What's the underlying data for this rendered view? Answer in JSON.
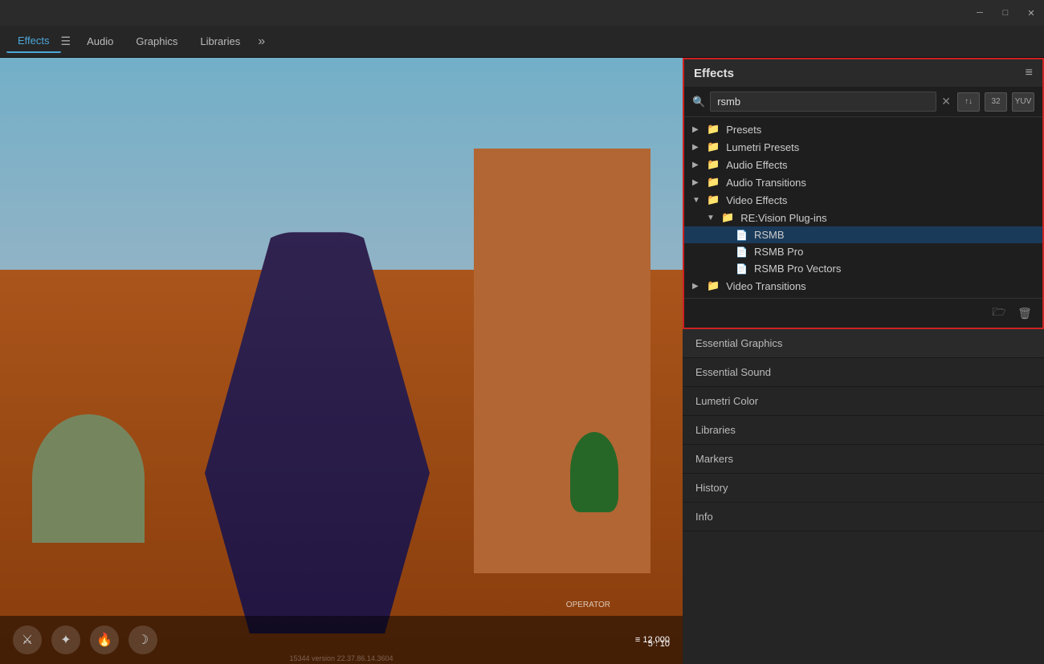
{
  "titlebar": {
    "minimize_label": "─",
    "maximize_label": "□",
    "close_label": "✕"
  },
  "tabs": {
    "items": [
      {
        "id": "effects",
        "label": "Effects",
        "active": true
      },
      {
        "id": "audio",
        "label": "Audio"
      },
      {
        "id": "graphics",
        "label": "Graphics"
      },
      {
        "id": "libraries",
        "label": "Libraries"
      }
    ],
    "more_label": "»"
  },
  "effects_panel": {
    "title": "Effects",
    "menu_icon": "≡",
    "search": {
      "placeholder": "Search",
      "value": "rsmb",
      "clear_icon": "✕",
      "btn_accelerate_label": "↑↓",
      "btn_32_label": "32",
      "btn_yuv_label": "YUV"
    },
    "tree": [
      {
        "id": "presets",
        "label": "Presets",
        "indent": 0,
        "expanded": false,
        "type": "folder"
      },
      {
        "id": "lumetri-presets",
        "label": "Lumetri Presets",
        "indent": 0,
        "expanded": false,
        "type": "folder"
      },
      {
        "id": "audio-effects",
        "label": "Audio Effects",
        "indent": 0,
        "expanded": false,
        "type": "folder"
      },
      {
        "id": "audio-transitions",
        "label": "Audio Transitions",
        "indent": 0,
        "expanded": false,
        "type": "folder"
      },
      {
        "id": "video-effects",
        "label": "Video Effects",
        "indent": 0,
        "expanded": true,
        "type": "folder"
      },
      {
        "id": "revision-plugins",
        "label": "RE:Vision Plug-ins",
        "indent": 1,
        "expanded": true,
        "type": "folder"
      },
      {
        "id": "rsmb",
        "label": "RSMB",
        "indent": 2,
        "expanded": false,
        "type": "effect",
        "selected": true
      },
      {
        "id": "rsmb-pro",
        "label": "RSMB Pro",
        "indent": 2,
        "expanded": false,
        "type": "effect"
      },
      {
        "id": "rsmb-pro-vectors",
        "label": "RSMB Pro Vectors",
        "indent": 2,
        "expanded": false,
        "type": "effect"
      },
      {
        "id": "video-transitions",
        "label": "Video Transitions",
        "indent": 0,
        "expanded": false,
        "type": "folder"
      }
    ],
    "bottom_icons": {
      "new_folder_icon": "🗁",
      "delete_icon": "🗑"
    }
  },
  "panel_list": {
    "items": [
      "Essential Graphics",
      "Essential Sound",
      "Lumetri Color",
      "Libraries",
      "Markers",
      "History",
      "Info"
    ]
  },
  "hud": {
    "operator_label": "OPERATOR",
    "ammo_label": "≡ 12,000",
    "kills_label": "5 ⫶ 10",
    "version_label": "15344 version 22.37.86.14.3604"
  }
}
